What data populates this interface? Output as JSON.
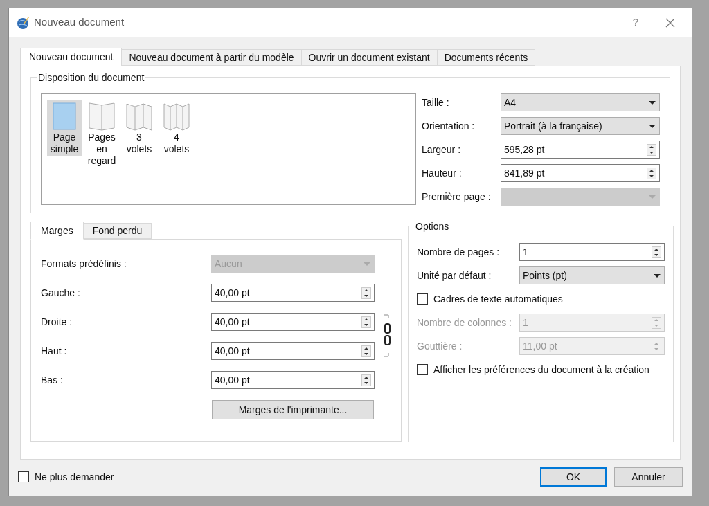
{
  "window": {
    "title": "Nouveau document",
    "help": "?"
  },
  "tabs": [
    {
      "label": "Nouveau document",
      "selected": true
    },
    {
      "label": "Nouveau document à partir du modèle",
      "selected": false
    },
    {
      "label": "Ouvrir un document existant",
      "selected": false
    },
    {
      "label": "Documents récents",
      "selected": false
    }
  ],
  "layout_group": {
    "title": "Disposition du document",
    "layouts": [
      {
        "kind": "single",
        "label": "Page simple",
        "selected": true
      },
      {
        "kind": "facing",
        "label": "Pages en regard",
        "selected": false
      },
      {
        "kind": "trifold",
        "label": "3 volets",
        "selected": false
      },
      {
        "kind": "fourfold",
        "label": "4 volets",
        "selected": false
      }
    ],
    "fields": [
      {
        "kind": "select",
        "label": "Taille :",
        "value": "A4",
        "disabled": false
      },
      {
        "kind": "select",
        "label": "Orientation :",
        "value": "Portrait (à la française)",
        "disabled": false
      },
      {
        "kind": "spin",
        "label": "Largeur :",
        "value": "595,28 pt",
        "disabled": false
      },
      {
        "kind": "spin",
        "label": "Hauteur :",
        "value": "841,89 pt",
        "disabled": false
      },
      {
        "kind": "select",
        "label": "Première page  :",
        "disabled": true
      }
    ]
  },
  "margins": {
    "tabs": [
      {
        "label": "Marges",
        "selected": true
      },
      {
        "label": "Fond perdu",
        "selected": false
      }
    ],
    "fields": [
      {
        "kind": "select",
        "label": "Formats prédéfinis :",
        "value": "Aucun",
        "disabled": true
      },
      {
        "kind": "spin",
        "label": "Gauche :",
        "value": "40,00 pt",
        "disabled": false
      },
      {
        "kind": "spin",
        "label": "Droite :",
        "value": "40,00 pt",
        "disabled": false
      },
      {
        "kind": "spin",
        "label": "Haut :",
        "value": "40,00 pt",
        "disabled": false
      },
      {
        "kind": "spin",
        "label": "Bas :",
        "value": "40,00 pt",
        "disabled": false
      }
    ],
    "printer_button": "Marges de l'imprimante..."
  },
  "options": {
    "title": "Options",
    "fields": [
      {
        "kind": "spin",
        "label": "Nombre de pages :",
        "value": "1",
        "disabled": false
      },
      {
        "kind": "select",
        "label": "Unité par défaut :",
        "value": "Points (pt)",
        "disabled": false
      },
      {
        "kind": "checkbox",
        "label": "Cadres de texte automatiques",
        "checked": false,
        "disabled": false
      },
      {
        "kind": "spin",
        "label": "Nombre de colonnes :",
        "value": "1",
        "disabled": true,
        "label_greyed": true
      },
      {
        "kind": "spin",
        "label": "Gouttière :",
        "value": "11,00 pt",
        "disabled": true,
        "label_greyed": true
      },
      {
        "kind": "checkbox",
        "label": "Afficher les préférences du document à la création",
        "checked": false,
        "disabled": false
      }
    ]
  },
  "footer": {
    "dont_ask": {
      "label": "Ne plus demander",
      "checked": false
    },
    "buttons": [
      {
        "label": "OK",
        "default": true
      },
      {
        "label": "Annuler",
        "default": false
      }
    ]
  }
}
